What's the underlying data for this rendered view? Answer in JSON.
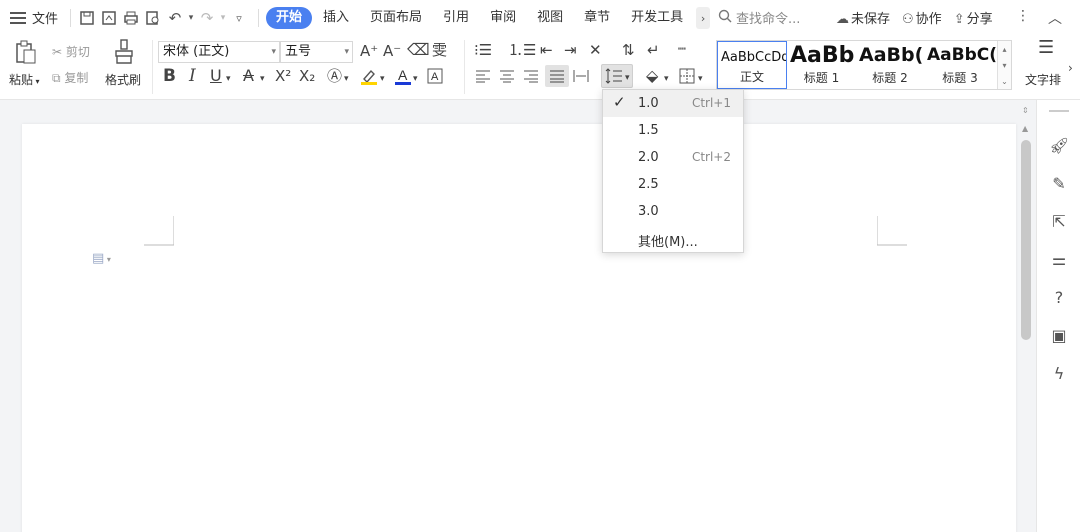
{
  "menubar": {
    "file_label": "文件",
    "tabs": [
      "开始",
      "插入",
      "页面布局",
      "引用",
      "审阅",
      "视图",
      "章节",
      "开发工具"
    ],
    "active_tab": "开始",
    "search_placeholder": "查找命令...",
    "unsaved_label": "未保存",
    "collab_label": "协作",
    "share_label": "分享"
  },
  "ribbon": {
    "paste_label": "粘贴",
    "cut_label": "剪切",
    "copy_label": "复制",
    "format_painter_label": "格式刷",
    "font_name": "宋体 (正文)",
    "font_size": "五号",
    "styles": [
      {
        "preview": "AaBbCcDd",
        "name": "正文"
      },
      {
        "preview": "AaBb",
        "name": "标题 1"
      },
      {
        "preview": "AaBb(",
        "name": "标题 2"
      },
      {
        "preview": "AaBbC(",
        "name": "标题 3"
      }
    ],
    "text_layout_label": "文字排"
  },
  "line_spacing_menu": {
    "items": [
      {
        "label": "1.0",
        "shortcut": "Ctrl+1",
        "checked": true
      },
      {
        "label": "1.5",
        "shortcut": "",
        "checked": false
      },
      {
        "label": "2.0",
        "shortcut": "Ctrl+2",
        "checked": false
      },
      {
        "label": "2.5",
        "shortcut": "",
        "checked": false
      },
      {
        "label": "3.0",
        "shortcut": "",
        "checked": false
      },
      {
        "label": "其他(M)...",
        "shortcut": "",
        "checked": false
      }
    ],
    "check_glyph": "✓"
  },
  "icons": {
    "cut": "scissors-icon",
    "copy": "copy-icon",
    "paste": "clipboard-icon",
    "format_painter": "brush-icon",
    "line_spacing": "line-spacing-icon"
  },
  "colors": {
    "accent": "#4a80f0",
    "highlight": "#ffd400",
    "font_color": "#1a3ad6"
  }
}
